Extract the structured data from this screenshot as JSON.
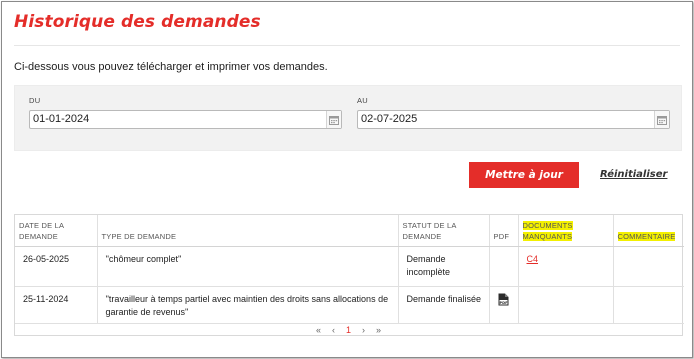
{
  "page": {
    "title": "Historique des demandes",
    "intro": "Ci-dessous vous pouvez télécharger et imprimer vos demandes."
  },
  "filters": {
    "from_label": "DU",
    "from_value": "01-01-2024",
    "to_label": "AU",
    "to_value": "02-07-2025",
    "update_label": "Mettre à jour",
    "reset_label": "Réinitialiser"
  },
  "table": {
    "headers": {
      "date": "DATE DE LA DEMANDE",
      "type": "TYPE DE DEMANDE",
      "status": "STATUT DE LA DEMANDE",
      "pdf": "PDF",
      "missing_docs": "DOCUMENTS MANQUANTS",
      "comment": "COMMENTAIRE"
    },
    "rows": [
      {
        "date": "26-05-2025",
        "type": "''chômeur complet''",
        "status": "Demande incomplète",
        "pdf": "",
        "missing_docs": "C4",
        "comment": ""
      },
      {
        "date": "25-11-2024",
        "type": "''travailleur à temps partiel avec maintien des droits sans allocations de garantie de revenus''",
        "status": "Demande finalisée",
        "pdf": "pdf-file-icon",
        "missing_docs": "",
        "comment": ""
      }
    ]
  },
  "pager": {
    "first": "«",
    "prev": "‹",
    "current": "1",
    "next": "›",
    "last": "»"
  },
  "colors": {
    "accent": "#e42d29",
    "highlight": "#f3f000",
    "panel": "#f2f2f2"
  }
}
